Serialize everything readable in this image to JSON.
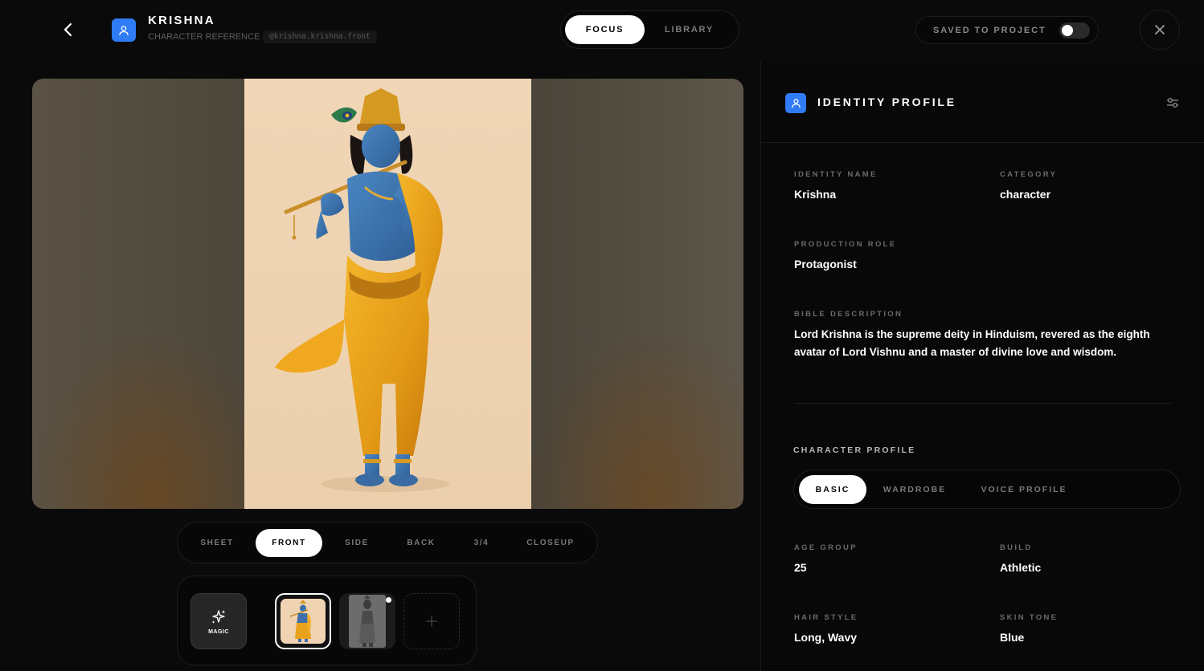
{
  "header": {
    "title": "KRISHNA",
    "subtitle": "CHARACTER REFERENCE",
    "tag": "@krishna.krishna.front",
    "back_icon": "chevron-left-icon",
    "user_icon": "user-icon"
  },
  "mode_toggle": {
    "focus": "FOCUS",
    "library": "LIBRARY",
    "active": "FOCUS"
  },
  "saved_toggle": {
    "label": "SAVED TO PROJECT",
    "on": false
  },
  "close_icon": "close-icon",
  "angle_tabs": {
    "items": [
      "SHEET",
      "FRONT",
      "SIDE",
      "BACK",
      "3/4",
      "CLOSEUP"
    ],
    "active": "FRONT"
  },
  "thumbnails": {
    "magic_label": "MAGIC",
    "magic_icon": "sparkles-icon",
    "add_icon": "plus-icon"
  },
  "panel": {
    "title": "IDENTITY PROFILE",
    "settings_icon": "sliders-icon",
    "identity_name_label": "IDENTITY NAME",
    "identity_name": "Krishna",
    "category_label": "CATEGORY",
    "category": "character",
    "role_label": "PRODUCTION ROLE",
    "role": "Protagonist",
    "description_label": "BIBLE DESCRIPTION",
    "description": "Lord Krishna is the supreme deity in Hinduism, revered as the eighth avatar of Lord Vishnu and a master of divine love and wisdom.",
    "character_profile_title": "CHARACTER PROFILE",
    "profile_tabs": [
      "BASIC",
      "WARDROBE",
      "VOICE PROFILE"
    ],
    "active_profile_tab": "BASIC",
    "age_group_label": "AGE GROUP",
    "age_group": "25",
    "build_label": "BUILD",
    "build": "Athletic",
    "hair_style_label": "HAIR STYLE",
    "hair_style": "Long, Wavy",
    "skin_tone_label": "SKIN TONE",
    "skin_tone": "Blue"
  },
  "colors": {
    "accent": "#2f7cf6",
    "background": "#0a0a0a",
    "art_background": "#efd3b2",
    "robe": "#e8a21c",
    "skin": "#3f6fa8"
  }
}
